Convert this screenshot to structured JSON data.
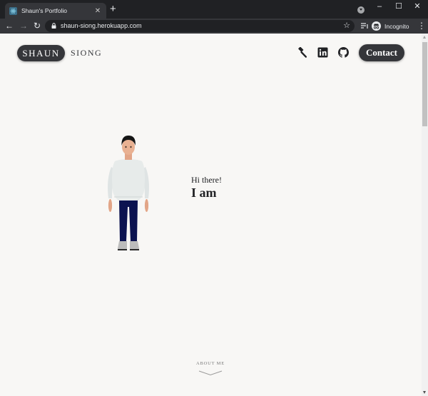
{
  "browser": {
    "tab_title": "Shaun's Portfolio",
    "tab_close": "✕",
    "new_tab": "+",
    "window_controls": {
      "minimize": "–",
      "maximize": "☐",
      "close": "✕"
    },
    "nav": {
      "back": "←",
      "forward": "→",
      "reload": "↻"
    },
    "url": "shaun-siong.herokuapp.com",
    "bookmark_star": "☆",
    "profile_label": "Incognito",
    "menu": "⋮"
  },
  "header": {
    "logo_first": "SHAUN",
    "logo_second": "SIONG",
    "icons": [
      "hammer-icon",
      "linkedin-icon",
      "github-icon"
    ],
    "contact_label": "Contact"
  },
  "hero": {
    "greeting": "Hi there!",
    "headline": "I am"
  },
  "footer": {
    "scroll_label": "ABOUT ME"
  },
  "colors": {
    "chrome_dark": "#202124",
    "chrome_tab": "#35363a",
    "page_bg": "#f8f7f5",
    "pill_bg": "#35363a"
  }
}
